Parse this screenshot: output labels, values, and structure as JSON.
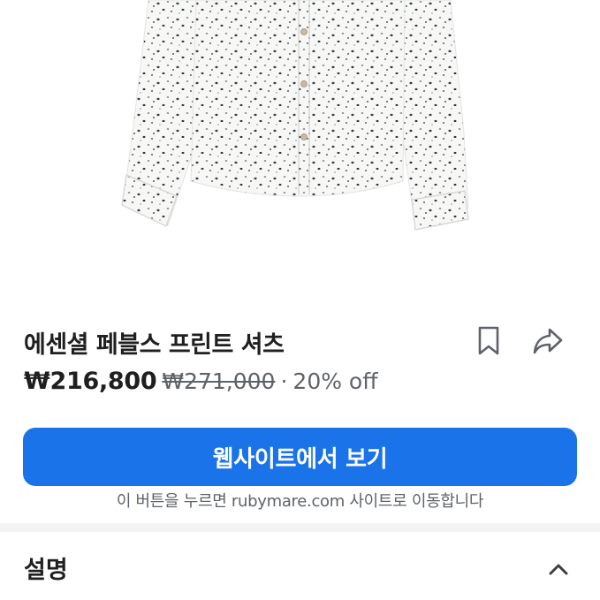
{
  "product": {
    "title": "에센셜 페블스 프린트 셔츠",
    "price": "₩216,800",
    "original_price": "₩271,000",
    "separator": "·",
    "discount": "20% off"
  },
  "actions": {
    "bookmark_icon": "bookmark-icon",
    "share_icon": "share-icon"
  },
  "cta": {
    "label": "웹사이트에서 보기",
    "note": "이 버튼을 누르면 rubymare.com 사이트로 이동합니다"
  },
  "description": {
    "title": "설명",
    "expanded": true,
    "toggle_icon": "chevron-up-icon"
  },
  "colors": {
    "accent": "#1a73e8",
    "text_primary": "#1f1f1f",
    "text_secondary": "#5f6368",
    "divider": "#f1f3f4"
  }
}
